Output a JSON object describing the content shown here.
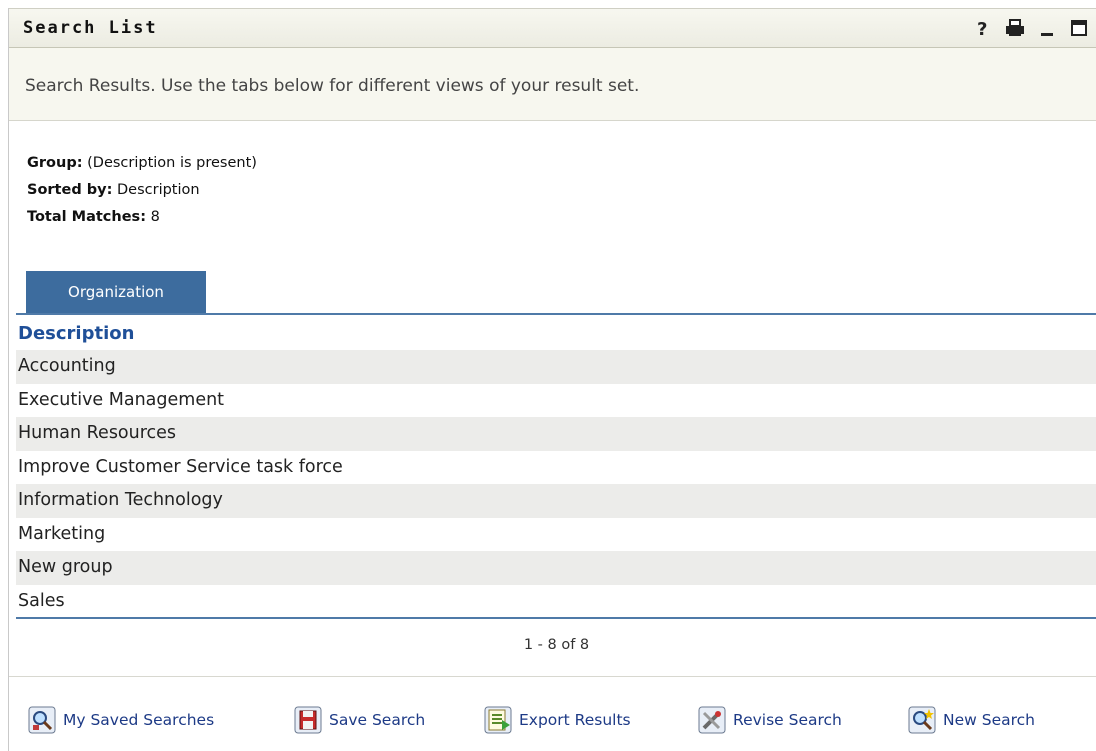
{
  "window": {
    "title": "Search List",
    "icons": [
      "help-icon",
      "print-icon",
      "minimize-icon",
      "maximize-icon"
    ]
  },
  "intro": {
    "text": "Search Results. Use the tabs below for different views of your result set."
  },
  "summary": {
    "group_label": "Group:",
    "group_value": "(Description is present)",
    "sorted_label": "Sorted by:",
    "sorted_value": "Description",
    "total_label": "Total Matches:",
    "total_value": "8"
  },
  "tabs": [
    {
      "label": "Organization",
      "active": true
    }
  ],
  "table": {
    "header": "Description",
    "rows": [
      "Accounting",
      "Executive Management",
      "Human Resources",
      "Improve Customer Service task force",
      "Information Technology",
      "Marketing",
      "New group",
      "Sales"
    ]
  },
  "pager": {
    "text": "1 - 8 of 8"
  },
  "actions": [
    {
      "label": "My Saved Searches",
      "icon": "saved-searches-icon"
    },
    {
      "label": "Save Search",
      "icon": "save-icon"
    },
    {
      "label": "Export Results",
      "icon": "export-icon"
    },
    {
      "label": "Revise Search",
      "icon": "revise-icon"
    },
    {
      "label": "New Search",
      "icon": "new-search-icon"
    }
  ],
  "colors": {
    "accent": "#3d6c9e",
    "header_text": "#1f4f98",
    "link": "#1d3a86",
    "row_alt": "#ececea"
  }
}
